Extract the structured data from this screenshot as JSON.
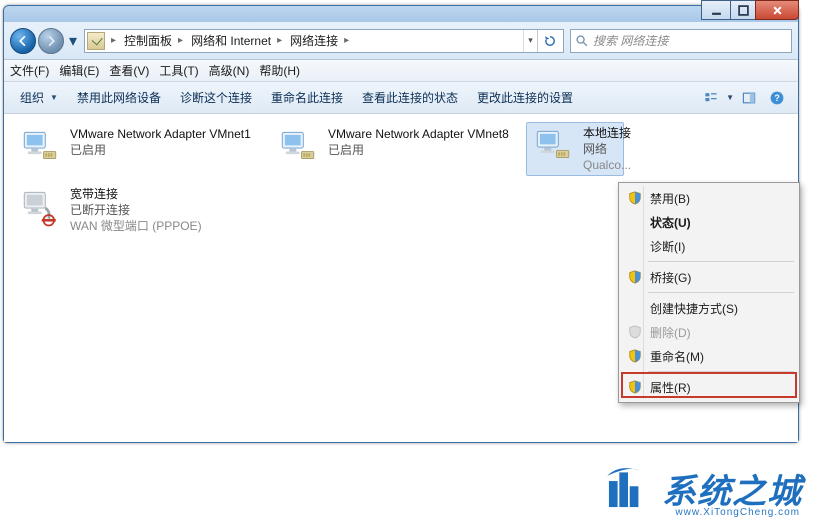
{
  "window": {
    "breadcrumbs": [
      "控制面板",
      "网络和 Internet",
      "网络连接"
    ],
    "search_placeholder": "搜索 网络连接"
  },
  "menubar": {
    "file": "文件(F)",
    "edit": "编辑(E)",
    "view": "查看(V)",
    "tools": "工具(T)",
    "advanced": "高级(N)",
    "help": "帮助(H)"
  },
  "toolbar": {
    "organize": "组织",
    "disable_device": "禁用此网络设备",
    "diagnose": "诊断这个连接",
    "rename": "重命名此连接",
    "view_status": "查看此连接的状态",
    "change_settings": "更改此连接的设置"
  },
  "connections": [
    {
      "name": "VMware Network Adapter VMnet1",
      "status": "已启用",
      "detail": ""
    },
    {
      "name": "VMware Network Adapter VMnet8",
      "status": "已启用",
      "detail": ""
    },
    {
      "name": "本地连接",
      "status": "网络",
      "detail": "Qualco..."
    },
    {
      "name": "宽带连接",
      "status": "已断开连接",
      "detail": "WAN 微型端口 (PPPOE)"
    }
  ],
  "context_menu": {
    "disable": "禁用(B)",
    "status": "状态(U)",
    "diagnose": "诊断(I)",
    "bridge": "桥接(G)",
    "create_shortcut": "创建快捷方式(S)",
    "delete": "删除(D)",
    "rename": "重命名(M)",
    "properties": "属性(R)"
  },
  "watermark": {
    "text": "系统之城",
    "url": "www.XiTongCheng.com"
  }
}
